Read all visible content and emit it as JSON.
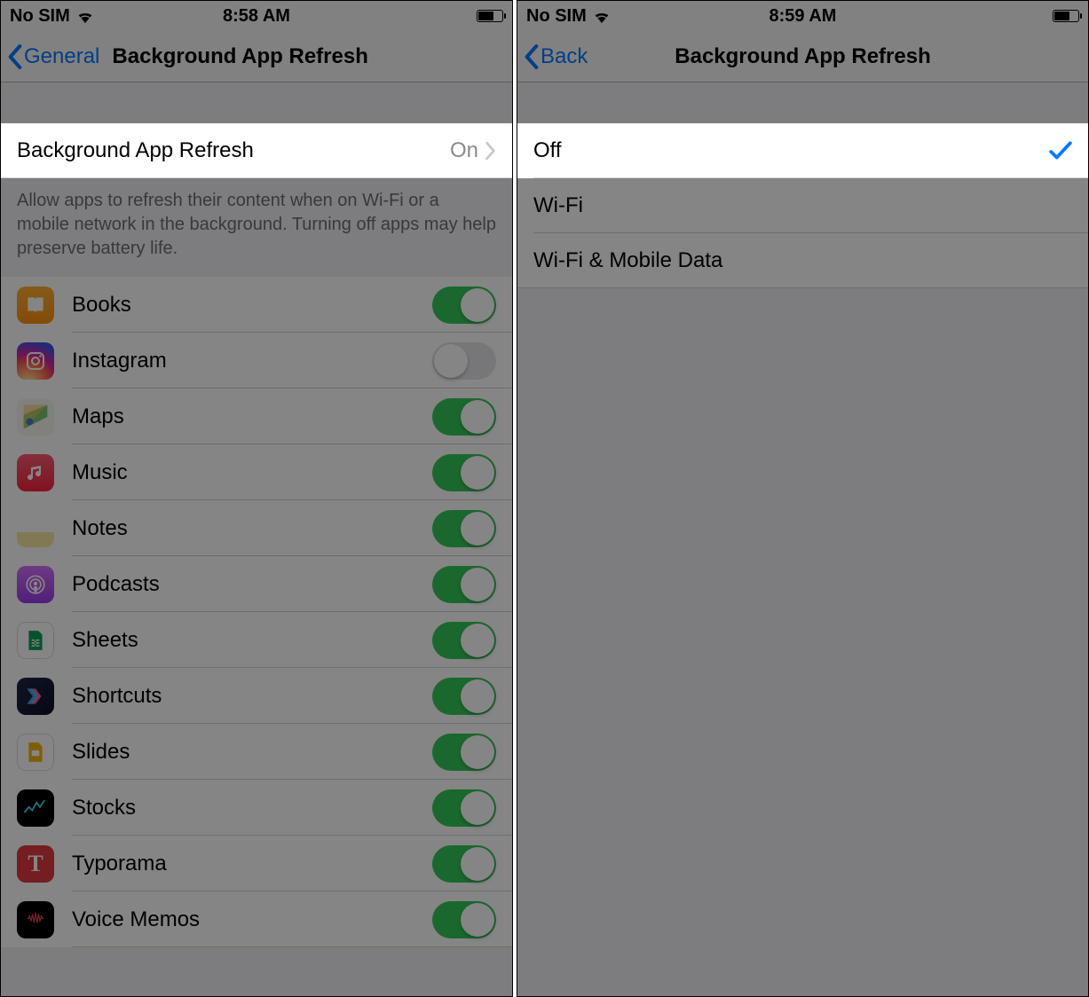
{
  "left": {
    "status": {
      "carrier": "No SIM",
      "time": "8:58 AM"
    },
    "nav": {
      "back": "General",
      "title": "Background App Refresh"
    },
    "master_cell": {
      "label": "Background App Refresh",
      "value": "On"
    },
    "footer": "Allow apps to refresh their content when on Wi-Fi or a mobile network in the background. Turning off apps may help preserve battery life.",
    "apps": [
      {
        "name": "Books",
        "icon": "books",
        "on": true
      },
      {
        "name": "Instagram",
        "icon": "instagram",
        "on": false
      },
      {
        "name": "Maps",
        "icon": "maps",
        "on": true
      },
      {
        "name": "Music",
        "icon": "music",
        "on": true
      },
      {
        "name": "Notes",
        "icon": "notes",
        "on": true
      },
      {
        "name": "Podcasts",
        "icon": "podcasts",
        "on": true
      },
      {
        "name": "Sheets",
        "icon": "sheets",
        "on": true
      },
      {
        "name": "Shortcuts",
        "icon": "shortcuts",
        "on": true
      },
      {
        "name": "Slides",
        "icon": "slides",
        "on": true
      },
      {
        "name": "Stocks",
        "icon": "stocks",
        "on": true
      },
      {
        "name": "Typorama",
        "icon": "typorama",
        "on": true
      },
      {
        "name": "Voice Memos",
        "icon": "voicememos",
        "on": true
      }
    ]
  },
  "right": {
    "status": {
      "carrier": "No SIM",
      "time": "8:59 AM"
    },
    "nav": {
      "back": "Back",
      "title": "Background App Refresh"
    },
    "options": [
      {
        "label": "Off",
        "selected": true
      },
      {
        "label": "Wi-Fi",
        "selected": false
      },
      {
        "label": "Wi-Fi & Mobile Data",
        "selected": false
      }
    ]
  }
}
